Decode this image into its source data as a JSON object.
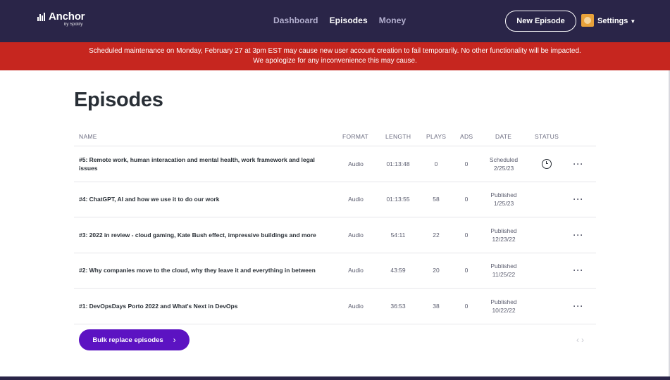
{
  "brand": {
    "name": "Anchor",
    "sub": "by Spotify"
  },
  "nav": {
    "items": [
      "Dashboard",
      "Episodes",
      "Money"
    ],
    "active": "Episodes"
  },
  "header": {
    "new_episode": "New Episode",
    "settings": "Settings"
  },
  "banner": {
    "text": "Scheduled maintenance on Monday, February 27 at 3pm EST may cause new user account creation to fail temporarily. No other functionality will be impacted. We apologize for any inconvenience this may cause."
  },
  "page": {
    "title": "Episodes"
  },
  "table": {
    "columns": {
      "name": "NAME",
      "format": "FORMAT",
      "length": "LENGTH",
      "plays": "PLAYS",
      "ads": "ADS",
      "date": "DATE",
      "status": "STATUS"
    },
    "rows": [
      {
        "name": "#5: Remote work, human interacation and mental health, work framework and legal issues",
        "format": "Audio",
        "length": "01:13:48",
        "plays": "0",
        "ads": "0",
        "date_status": "Scheduled",
        "date": "2/25/23",
        "status_icon": "clock-icon",
        "more": "···"
      },
      {
        "name": "#4: ChatGPT, AI and how we use it to do our work",
        "format": "Audio",
        "length": "01:13:55",
        "plays": "58",
        "ads": "0",
        "date_status": "Published",
        "date": "1/25/23",
        "status_icon": "",
        "more": "···"
      },
      {
        "name": "#3: 2022 in review - cloud gaming, Kate Bush effect, impressive buildings and more",
        "format": "Audio",
        "length": "54:11",
        "plays": "22",
        "ads": "0",
        "date_status": "Published",
        "date": "12/23/22",
        "status_icon": "",
        "more": "···"
      },
      {
        "name": "#2: Why companies move to the cloud, why they leave it and everything in between",
        "format": "Audio",
        "length": "43:59",
        "plays": "20",
        "ads": "0",
        "date_status": "Published",
        "date": "11/25/22",
        "status_icon": "",
        "more": "···"
      },
      {
        "name": "#1: DevOpsDays Porto 2022 and What's Next in DevOps",
        "format": "Audio",
        "length": "36:53",
        "plays": "38",
        "ads": "0",
        "date_status": "Published",
        "date": "10/22/22",
        "status_icon": "",
        "more": "···"
      }
    ]
  },
  "actions": {
    "bulk_replace": "Bulk replace episodes",
    "bulk_chevron": "›",
    "prev": "‹",
    "next": "›"
  },
  "colors": {
    "nav_bg": "#2a2548",
    "banner_bg": "#c6261f",
    "accent": "#5c13c2"
  }
}
